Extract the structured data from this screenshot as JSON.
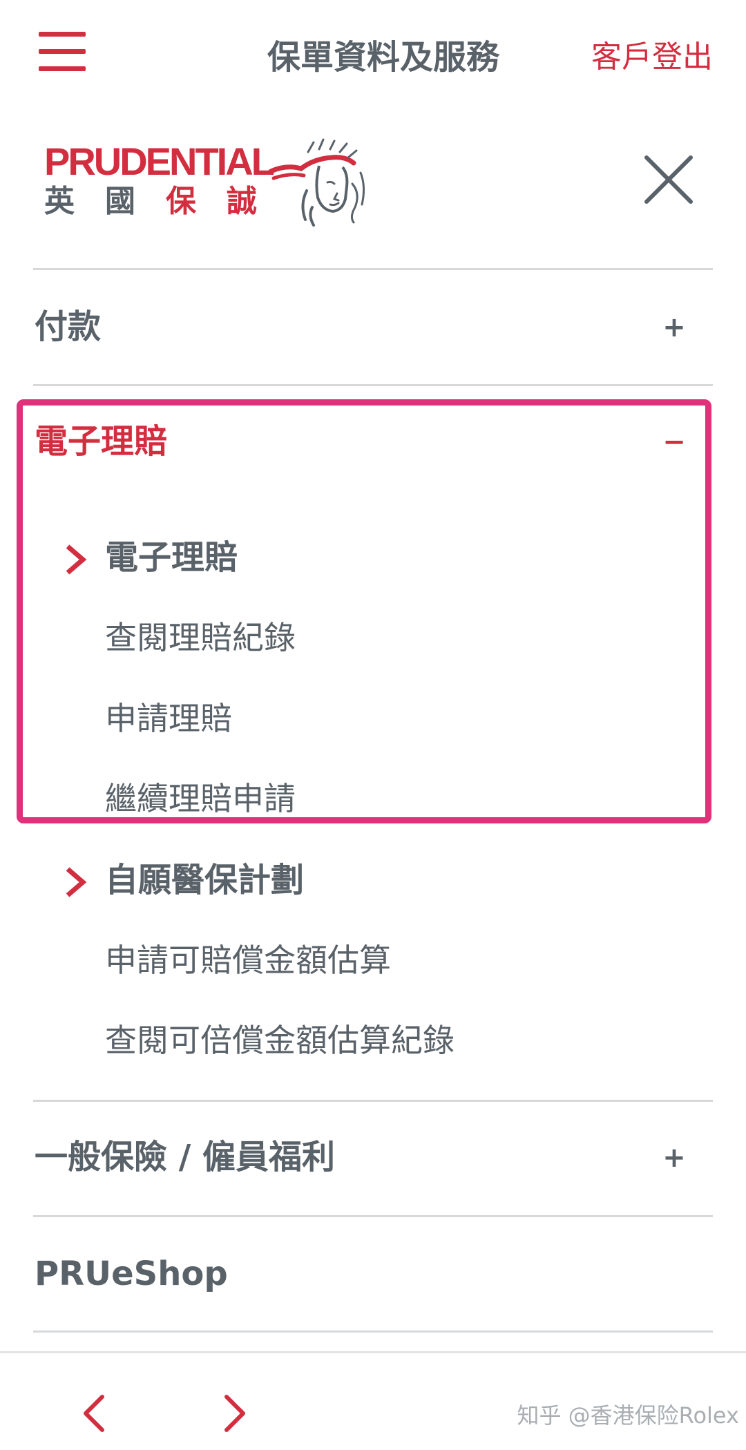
{
  "header": {
    "title": "保單資料及服務",
    "logout_label": "客戶登出"
  },
  "logo": {
    "wordmark": "PRUDENTIAL",
    "cjk": [
      "英",
      "國",
      "保",
      "誠"
    ]
  },
  "menu": {
    "sections": [
      {
        "label": "付款",
        "toggle": "+"
      },
      {
        "label": "電子理賠",
        "toggle": "−"
      },
      {
        "label": "一般保險 / 僱員福利",
        "toggle": "+"
      },
      {
        "label": "PRUeShop"
      }
    ],
    "groups": [
      {
        "heading": "電子理賠",
        "links": [
          "查閱理賠紀錄",
          "申請理賠",
          "繼續理賠申請"
        ]
      },
      {
        "heading": "自願醫保計劃",
        "links": [
          "申請可賠償金額估算",
          "查閱可倍償金額估算紀錄"
        ]
      }
    ]
  },
  "footer": {
    "watermark": "知乎 @香港保险Rolex"
  },
  "colors": {
    "brand_red": "#d22e3f",
    "highlight_pink": "#e0317a",
    "text_gray": "#5a6269"
  }
}
